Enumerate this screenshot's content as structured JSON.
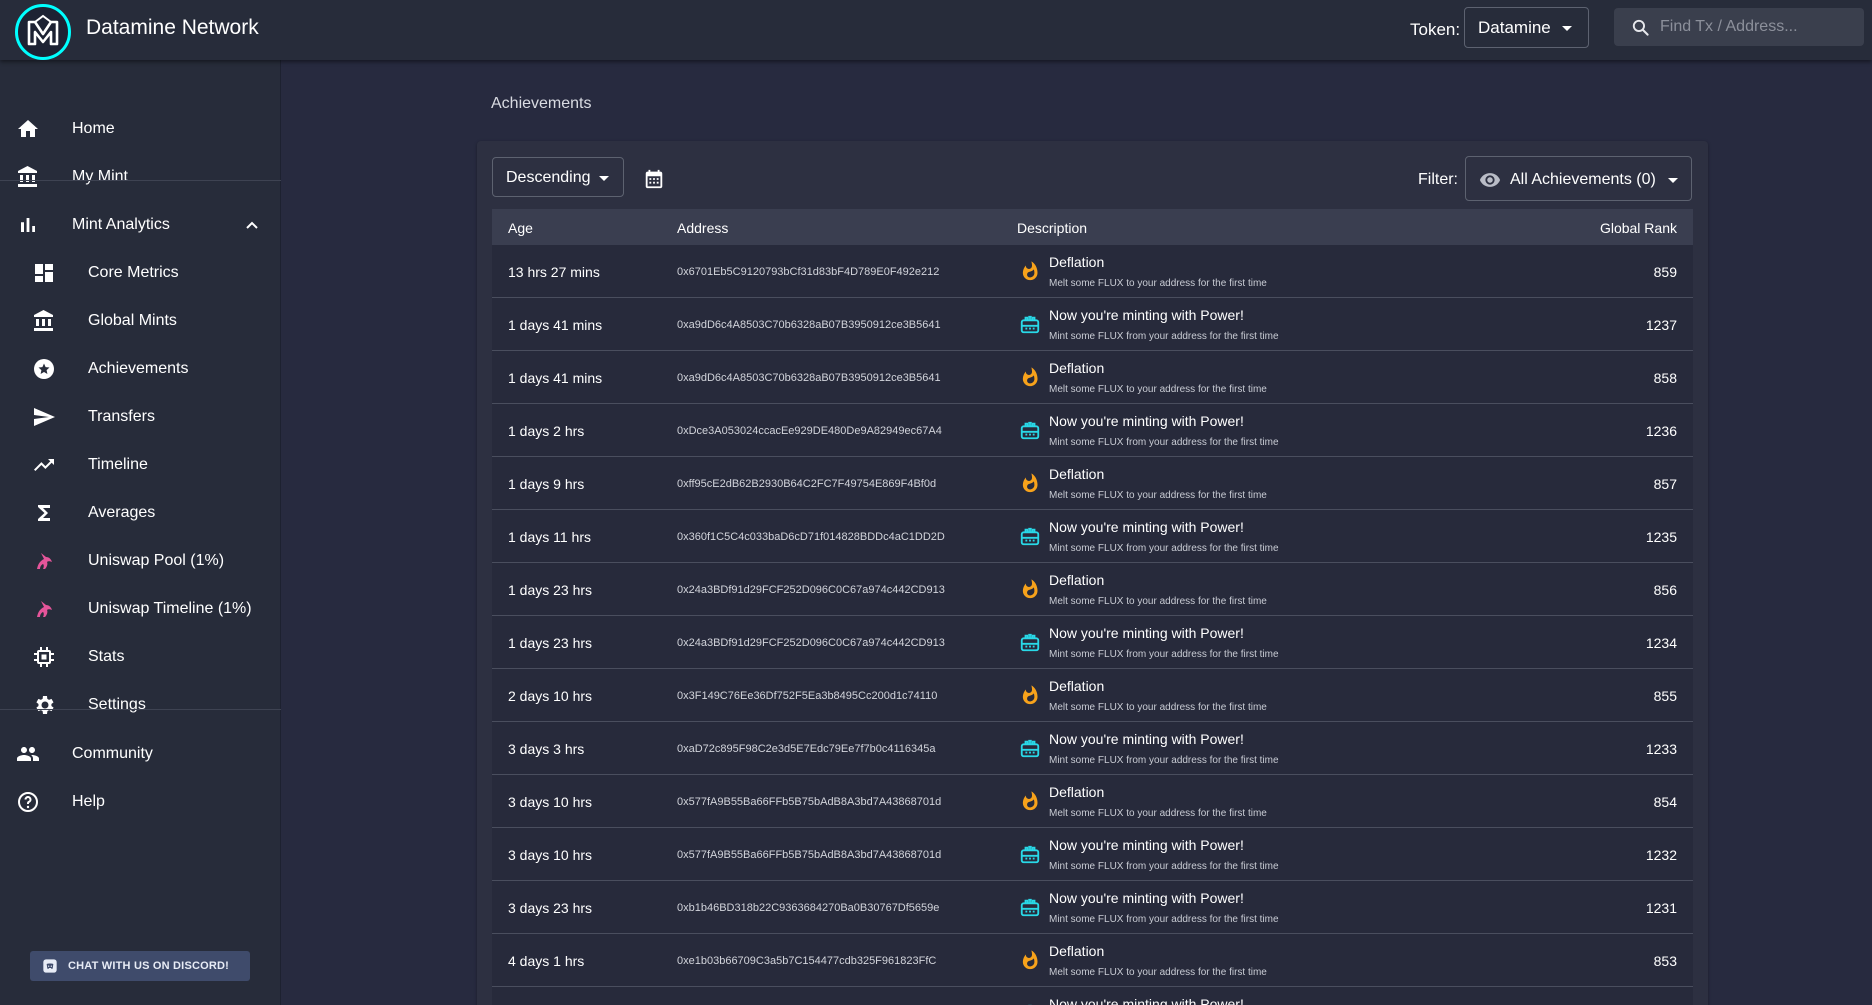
{
  "app": {
    "title": "Datamine Network",
    "logo_icon": "datamine-logo-icon"
  },
  "header": {
    "token_label": "Token:",
    "token_value": "Datamine",
    "search_placeholder": "Find Tx / Address..."
  },
  "sidebar": {
    "items": [
      {
        "label": "Home",
        "icon": "home-icon"
      },
      {
        "label": "My Mint",
        "icon": "bank-icon"
      },
      {
        "label": "Mint Analytics",
        "icon": "bar-chart-icon"
      },
      {
        "label": "Core Metrics",
        "icon": "dashboard-icon"
      },
      {
        "label": "Global Mints",
        "icon": "bank-icon"
      },
      {
        "label": "Achievements",
        "icon": "star-circle-icon"
      },
      {
        "label": "Transfers",
        "icon": "send-icon"
      },
      {
        "label": "Timeline",
        "icon": "trending-up-icon"
      },
      {
        "label": "Averages",
        "icon": "sigma-icon"
      },
      {
        "label": "Uniswap Pool (1%)",
        "icon": "unicorn-icon"
      },
      {
        "label": "Uniswap Timeline (1%)",
        "icon": "unicorn-icon"
      },
      {
        "label": "Stats",
        "icon": "chip-icon"
      },
      {
        "label": "Settings",
        "icon": "gear-icon"
      },
      {
        "label": "Community",
        "icon": "people-icon"
      },
      {
        "label": "Help",
        "icon": "help-icon"
      }
    ],
    "discord_button": "CHAT WITH US ON DISCORD!"
  },
  "main": {
    "heading": "Achievements",
    "sort_value": "Descending",
    "filter_label": "Filter:",
    "filter_value": "All Achievements (0)",
    "columns": [
      "Age",
      "Address",
      "Description",
      "Global Rank"
    ],
    "rows": [
      {
        "age": "13 hrs 27 mins",
        "address": "0x6701Eb5C9120793bCf31d83bF4D789E0F492e212",
        "type": "deflation",
        "title": "Deflation",
        "sub": "Melt some FLUX to your address for the first time",
        "rank": "859"
      },
      {
        "age": "1 days 41 mins",
        "address": "0xa9dD6c4A8503C70b6328aB07B3950912ce3B5641",
        "type": "power",
        "title": "Now you're minting with Power!",
        "sub": "Mint some FLUX from your address for the first time",
        "rank": "1237"
      },
      {
        "age": "1 days 41 mins",
        "address": "0xa9dD6c4A8503C70b6328aB07B3950912ce3B5641",
        "type": "deflation",
        "title": "Deflation",
        "sub": "Melt some FLUX to your address for the first time",
        "rank": "858"
      },
      {
        "age": "1 days 2 hrs",
        "address": "0xDce3A053024ccacEe929DE480De9A82949ec67A4",
        "type": "power",
        "title": "Now you're minting with Power!",
        "sub": "Mint some FLUX from your address for the first time",
        "rank": "1236"
      },
      {
        "age": "1 days 9 hrs",
        "address": "0xff95cE2dB62B2930B64C2FC7F49754E869F4Bf0d",
        "type": "deflation",
        "title": "Deflation",
        "sub": "Melt some FLUX to your address for the first time",
        "rank": "857"
      },
      {
        "age": "1 days 11 hrs",
        "address": "0x360f1C5C4c033baD6cD71f014828BDDc4aC1DD2D",
        "type": "power",
        "title": "Now you're minting with Power!",
        "sub": "Mint some FLUX from your address for the first time",
        "rank": "1235"
      },
      {
        "age": "1 days 23 hrs",
        "address": "0x24a3BDf91d29FCF252D096C0C67a974c442CD913",
        "type": "deflation",
        "title": "Deflation",
        "sub": "Melt some FLUX to your address for the first time",
        "rank": "856"
      },
      {
        "age": "1 days 23 hrs",
        "address": "0x24a3BDf91d29FCF252D096C0C67a974c442CD913",
        "type": "power",
        "title": "Now you're minting with Power!",
        "sub": "Mint some FLUX from your address for the first time",
        "rank": "1234"
      },
      {
        "age": "2 days 10 hrs",
        "address": "0x3F149C76Ee36Df752F5Ea3b8495Cc200d1c74110",
        "type": "deflation",
        "title": "Deflation",
        "sub": "Melt some FLUX to your address for the first time",
        "rank": "855"
      },
      {
        "age": "3 days 3 hrs",
        "address": "0xaD72c895F98C2e3d5E7Edc79Ee7f7b0c4116345a",
        "type": "power",
        "title": "Now you're minting with Power!",
        "sub": "Mint some FLUX from your address for the first time",
        "rank": "1233"
      },
      {
        "age": "3 days 10 hrs",
        "address": "0x577fA9B55Ba66FFb5B75bAdB8A3bd7A43868701d",
        "type": "deflation",
        "title": "Deflation",
        "sub": "Melt some FLUX to your address for the first time",
        "rank": "854"
      },
      {
        "age": "3 days 10 hrs",
        "address": "0x577fA9B55Ba66FFb5B75bAdB8A3bd7A43868701d",
        "type": "power",
        "title": "Now you're minting with Power!",
        "sub": "Mint some FLUX from your address for the first time",
        "rank": "1232"
      },
      {
        "age": "3 days 23 hrs",
        "address": "0xb1b46BD318b22C9363684270Ba0B30767Df5659e",
        "type": "power",
        "title": "Now you're minting with Power!",
        "sub": "Mint some FLUX from your address for the first time",
        "rank": "1231"
      },
      {
        "age": "4 days 1 hrs",
        "address": "0xe1b03b66709C3a5b7C154477cdb325F961823FfC",
        "type": "deflation",
        "title": "Deflation",
        "sub": "Melt some FLUX to your address for the first time",
        "rank": "853"
      },
      {
        "age": "",
        "address": "",
        "type": "power",
        "title": "Now you're minting with Power!",
        "sub": "",
        "rank": ""
      }
    ]
  },
  "colors": {
    "background": "#272a3f",
    "sidebar": "#272c3a",
    "flame": "#f7a21b",
    "power_icon": "#29d9e8",
    "unicorn": "#e5559a",
    "discord_button": "#3f4b6b"
  }
}
